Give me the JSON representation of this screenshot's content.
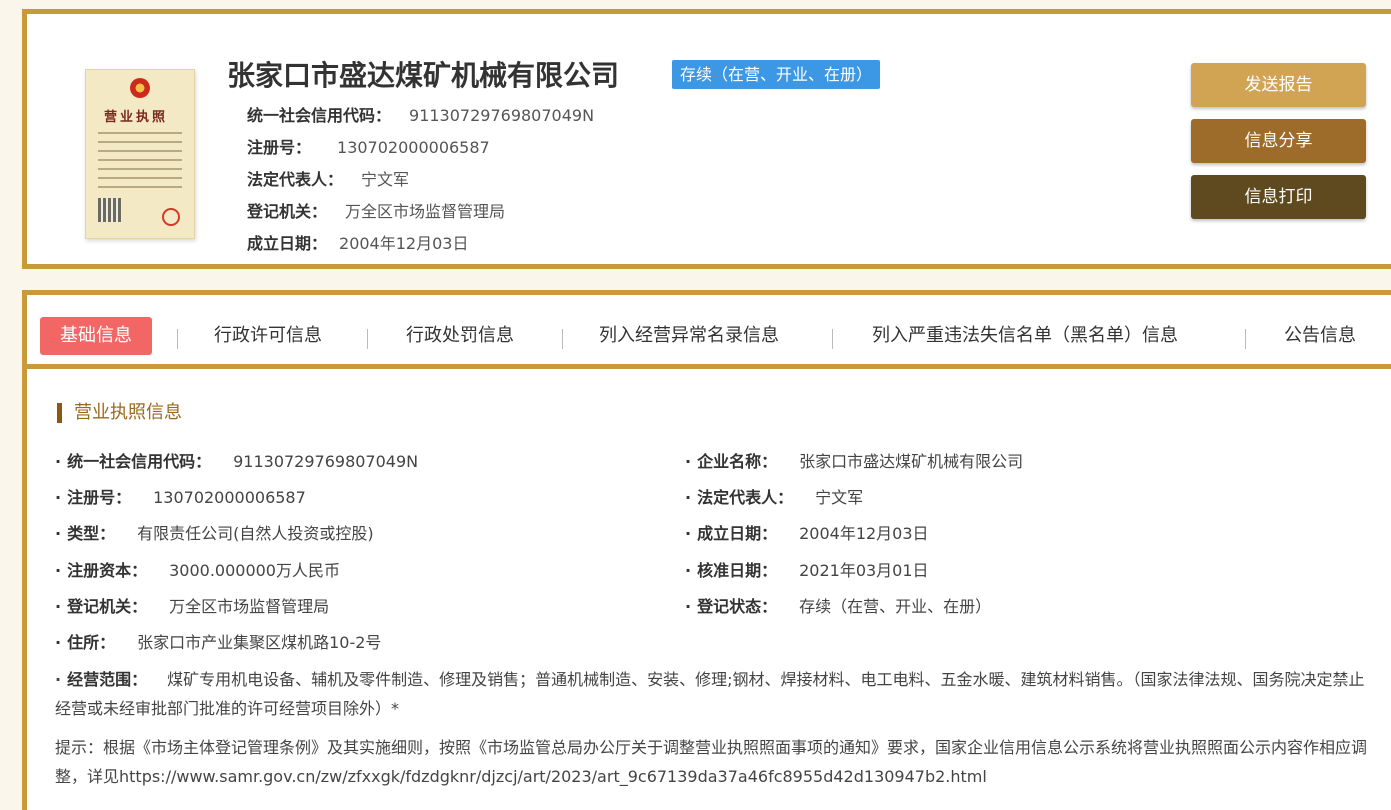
{
  "header": {
    "company_name": "张家口市盛达煤矿机械有限公司",
    "status_badge": "存续（在营、开业、在册）",
    "license_thumb_title": "营业执照",
    "fields": [
      {
        "label": "统一社会信用代码：",
        "value": "91130729769807049N"
      },
      {
        "label": "注册号：",
        "value": "130702000006587"
      },
      {
        "label": "法定代表人：",
        "value": "宁文军"
      },
      {
        "label": "登记机关：",
        "value": "万全区市场监督管理局"
      },
      {
        "label": "成立日期：",
        "value": "2004年12月03日"
      }
    ],
    "buttons": {
      "send": "发送报告",
      "share": "信息分享",
      "print": "信息打印"
    }
  },
  "tabs": [
    {
      "label": "基础信息",
      "active": true
    },
    {
      "label": "行政许可信息"
    },
    {
      "label": "行政处罚信息"
    },
    {
      "label": "列入经营异常名录信息"
    },
    {
      "label": "列入严重违法失信名单（黑名单）信息"
    },
    {
      "label": "公告信息"
    }
  ],
  "section": {
    "title": "营业执照信息",
    "left": [
      {
        "label": "统一社会信用代码：",
        "value": "91130729769807049N"
      },
      {
        "label": "注册号：",
        "value": "130702000006587"
      },
      {
        "label": "类型：",
        "value": "有限责任公司(自然人投资或控股)"
      },
      {
        "label": "注册资本：",
        "value": "3000.000000万人民币"
      },
      {
        "label": "登记机关：",
        "value": "万全区市场监督管理局"
      },
      {
        "label": "住所：",
        "value": "张家口市产业集聚区煤机路10-2号"
      }
    ],
    "right": [
      {
        "label": "企业名称：",
        "value": "张家口市盛达煤矿机械有限公司"
      },
      {
        "label": "法定代表人：",
        "value": "宁文军"
      },
      {
        "label": "成立日期：",
        "value": "2004年12月03日"
      },
      {
        "label": "核准日期：",
        "value": "2021年03月01日"
      },
      {
        "label": "登记状态：",
        "value": "存续（在营、开业、在册）"
      }
    ],
    "scope_label": "经营范围：",
    "scope_value": "煤矿专用机电设备、辅机及零件制造、修理及销售；普通机械制造、安装、修理;钢材、焊接材料、电工电料、五金水暖、建筑材料销售。（国家法律法规、国务院决定禁止经营或未经审批部门批准的许可经营项目除外）*",
    "notice": "提示：根据《市场主体登记管理条例》及其实施细则，按照《市场监管总局办公厅关于调整营业执照照面事项的通知》要求，国家企业信用信息公示系统将营业执照照面公示内容作相应调整，详见https://www.samr.gov.cn/zw/zfxxgk/fdzdgknr/djzcj/art/2023/art_9c67139da37a46fc8955d42d130947b2.html"
  }
}
